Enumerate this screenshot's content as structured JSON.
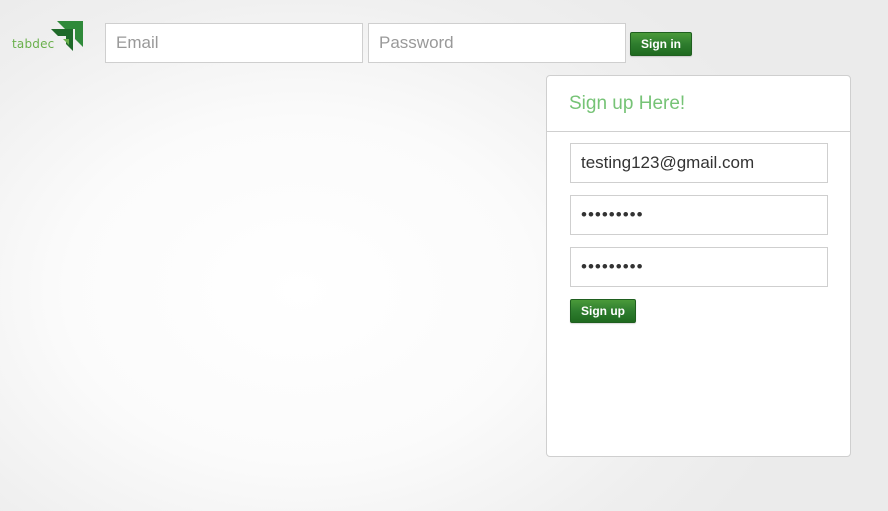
{
  "brand": {
    "logo_text": "tabdec",
    "accent_color": "#6ab04c"
  },
  "header": {
    "email": {
      "placeholder": "Email",
      "value": ""
    },
    "password": {
      "placeholder": "Password",
      "value": ""
    },
    "signin_label": "Sign in"
  },
  "signup": {
    "title": "Sign up Here!",
    "email_value": "testing123@gmail.com",
    "password_value": "abcdefghi",
    "confirm_password_value": "abcdefghi",
    "button_label": "Sign up",
    "title_color": "#76c376",
    "button_color": "#2e7d2e"
  }
}
